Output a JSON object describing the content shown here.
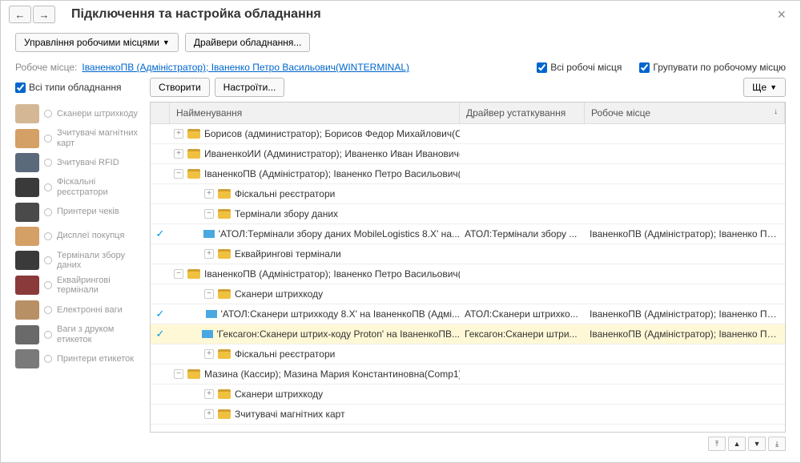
{
  "header": {
    "title": "Підключення та настройка обладнання"
  },
  "toolbar": {
    "workplace_mgmt": "Управління робочими місцями",
    "drivers": "Драйвери обладнання..."
  },
  "workplace": {
    "label": "Робоче місце:",
    "link": "ІваненкоПВ (Адміністратор); Іваненко Петро Васильович(WINTERMINAL)",
    "all_workplaces": "Всі робочі місця",
    "group_by": "Групувати по робочому місцю"
  },
  "sidebar": {
    "all_types": "Всі типи обладнання",
    "items": [
      {
        "label": "Сканери штрихкоду"
      },
      {
        "label": "Зчитувачі магнітних карт"
      },
      {
        "label": "Зчитувачі RFID"
      },
      {
        "label": "Фіскальні реєстратори"
      },
      {
        "label": "Принтери чеків"
      },
      {
        "label": "Дисплеї покупця"
      },
      {
        "label": "Термінали збору даних"
      },
      {
        "label": "Еквайрингові термінали"
      },
      {
        "label": "Електронні ваги"
      },
      {
        "label": "Ваги з друком етикеток"
      },
      {
        "label": "Принтери етикеток"
      }
    ]
  },
  "actions": {
    "create": "Створити",
    "settings": "Настроїти...",
    "more": "Ще"
  },
  "columns": {
    "name": "Найменування",
    "driver": "Драйвер устаткування",
    "workplace": "Робоче місце"
  },
  "rows": [
    {
      "indent": 0,
      "type": "folder",
      "exp": "+",
      "name": "Борисов (администратор); Борисов Федор Михайлович(Co...",
      "check": "",
      "driver": "",
      "wp": ""
    },
    {
      "indent": 0,
      "type": "folder",
      "exp": "+",
      "name": "ИваненкоИИ (Администратор); Иваненко Иван Иванович(О...",
      "check": "",
      "driver": "",
      "wp": ""
    },
    {
      "indent": 0,
      "type": "folder",
      "exp": "-",
      "name": "ІваненкоПВ (Адміністратор); Іваненко Петро Васильович(С...",
      "check": "",
      "driver": "",
      "wp": ""
    },
    {
      "indent": 1,
      "type": "folder",
      "exp": "+",
      "name": "Фіскальні реєстратори",
      "check": "",
      "driver": "",
      "wp": ""
    },
    {
      "indent": 1,
      "type": "folder",
      "exp": "-",
      "name": "Термінали збору даних",
      "check": "",
      "driver": "",
      "wp": ""
    },
    {
      "indent": 2,
      "type": "item",
      "exp": "",
      "name": "'АТОЛ:Термінали збору даних MobileLogistics 8.X' на...",
      "check": "✓",
      "driver": "АТОЛ:Термінали збору ...",
      "wp": "ІваненкоПВ (Адміністратор); Іваненко Пет..."
    },
    {
      "indent": 1,
      "type": "folder",
      "exp": "+",
      "name": "Еквайрингові термінали",
      "check": "",
      "driver": "",
      "wp": ""
    },
    {
      "indent": 0,
      "type": "folder",
      "exp": "-",
      "name": "ІваненкоПВ (Адміністратор); Іваненко Петро Васильович(...",
      "check": "",
      "driver": "",
      "wp": ""
    },
    {
      "indent": 1,
      "type": "folder",
      "exp": "-",
      "name": "Сканери штрихкоду",
      "check": "",
      "driver": "",
      "wp": ""
    },
    {
      "indent": 2,
      "type": "item",
      "exp": "",
      "name": "'АТОЛ:Сканери штрихкоду 8.X' на ІваненкоПВ (Адмі...",
      "check": "✓",
      "driver": "АТОЛ:Сканери штрихко...",
      "wp": "ІваненкоПВ (Адміністратор); Іваненко Пет..."
    },
    {
      "indent": 2,
      "type": "item",
      "exp": "",
      "name": "'Гексагон:Сканери штрих-коду Proton' на ІваненкоПВ...",
      "check": "✓",
      "driver": "Гексагон:Сканери штри...",
      "wp": "ІваненкоПВ (Адміністратор); Іваненко Пет...",
      "selected": true
    },
    {
      "indent": 1,
      "type": "folder",
      "exp": "+",
      "name": "Фіскальні реєстратори",
      "check": "",
      "driver": "",
      "wp": ""
    },
    {
      "indent": 0,
      "type": "folder",
      "exp": "-",
      "name": "Мазина (Кассир); Мазина Мария Константиновна(Comp1)",
      "check": "",
      "driver": "",
      "wp": ""
    },
    {
      "indent": 1,
      "type": "folder",
      "exp": "+",
      "name": "Сканери штрихкоду",
      "check": "",
      "driver": "",
      "wp": ""
    },
    {
      "indent": 1,
      "type": "folder",
      "exp": "+",
      "name": "Зчитувачі магнітних карт",
      "check": "",
      "driver": "",
      "wp": ""
    }
  ]
}
